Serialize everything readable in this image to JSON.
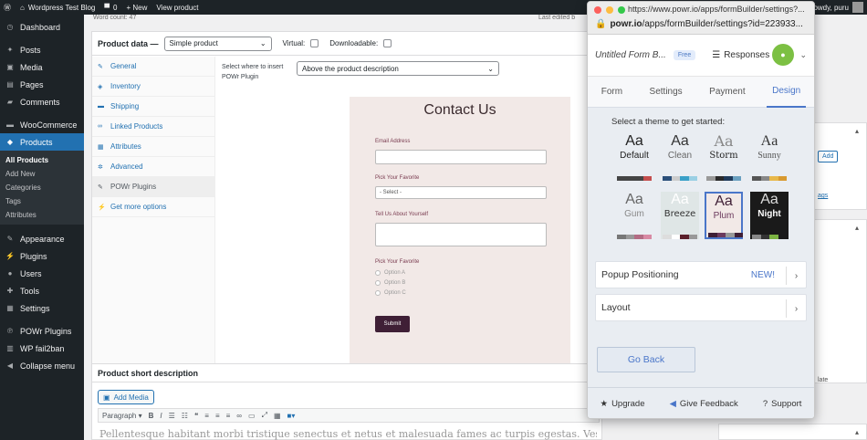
{
  "admin_bar": {
    "site_name": "Wordpress Test Blog",
    "comments_count": "0",
    "new_label": "+ New",
    "view_product": "View product",
    "howdy": "owdy, puru",
    "word_count": "Word count: 47",
    "last_edited": "Last edited b"
  },
  "sidebar": {
    "items": [
      {
        "label": "Dashboard",
        "icon": "gauge-icon"
      },
      {
        "label": "Posts",
        "icon": "pin-icon"
      },
      {
        "label": "Media",
        "icon": "media-icon"
      },
      {
        "label": "Pages",
        "icon": "pages-icon"
      },
      {
        "label": "Comments",
        "icon": "comments-icon"
      },
      {
        "label": "WooCommerce",
        "icon": "woo-icon"
      },
      {
        "label": "Products",
        "icon": "products-icon"
      }
    ],
    "submenu": [
      "All Products",
      "Add New",
      "Categories",
      "Tags",
      "Attributes"
    ],
    "items2": [
      {
        "label": "Appearance",
        "icon": "brush-icon"
      },
      {
        "label": "Plugins",
        "icon": "plugin-icon"
      },
      {
        "label": "Users",
        "icon": "users-icon"
      },
      {
        "label": "Tools",
        "icon": "tools-icon"
      },
      {
        "label": "Settings",
        "icon": "settings-icon"
      }
    ],
    "items3": [
      {
        "label": "POWr Plugins",
        "icon": "powr-icon"
      },
      {
        "label": "WP fail2ban",
        "icon": "shield-icon"
      },
      {
        "label": "Collapse menu",
        "icon": "collapse-icon"
      }
    ]
  },
  "product_data": {
    "title": "Product data —",
    "type": "Simple product",
    "virtual": "Virtual:",
    "downloadable": "Downloadable:",
    "tabs": [
      "General",
      "Inventory",
      "Shipping",
      "Linked Products",
      "Attributes",
      "Advanced",
      "POWr Plugins",
      "Get more options"
    ],
    "insert_label": "Select where to insert POWr Plugin",
    "insert_value": "Above the product description"
  },
  "form_preview": {
    "title": "Contact Us",
    "email_label": "Email Address",
    "pick_label": "Pick Your Favorite",
    "select_placeholder": "- Select -",
    "about_label": "Tell Us About Yourself",
    "pick_label_2": "Pick Your Favorite",
    "options": [
      "Option A",
      "Option B",
      "Option C"
    ],
    "submit": "Submit"
  },
  "short_desc": {
    "title": "Product short description",
    "add_media": "Add Media",
    "paragraph": "Paragraph",
    "body_text": "Pellentesque habitant morbi tristique senectus et netus et malesuada fames ac turpis egestas. Vestibulum tortor quam, feugiat vitae"
  },
  "right_col": {
    "add": "Add",
    "tags_link": "ags",
    "late": "late"
  },
  "popup": {
    "url": "https://www.powr.io/apps/formBuilder/settings?...",
    "path_domain": "powr.io",
    "path_rest": "/apps/formBuilder/settings?id=223933...",
    "form_title": "Untitled Form B...",
    "free_badge": "Free",
    "responses": "Responses",
    "tabs": [
      "Form",
      "Settings",
      "Payment",
      "Design"
    ],
    "active_tab": "Design",
    "theme_heading": "Select a theme to get started:",
    "themes": [
      {
        "name": "Default",
        "colors": [
          "#444444",
          "#444444",
          "#444444",
          "#c44e4e"
        ]
      },
      {
        "name": "Clean",
        "colors": [
          "#2b4f7a",
          "#cccccc",
          "#3aa0c8",
          "#9ad0e4"
        ]
      },
      {
        "name": "Storm",
        "colors": [
          "#999999",
          "#2a2a2a",
          "#1f3a5a",
          "#6aa0c0"
        ]
      },
      {
        "name": "Sunny",
        "colors": [
          "#555555",
          "#888888",
          "#e8b84a",
          "#d89a30"
        ]
      },
      {
        "name": "Gum",
        "colors": [
          "#777777",
          "#999999",
          "#b36c84",
          "#d88aa4"
        ]
      },
      {
        "name": "Breeze",
        "colors": [
          "#dddddd",
          "#ffffff",
          "#5a1f2a",
          "#999999"
        ]
      },
      {
        "name": "Plum",
        "colors": [
          "#3f1f36",
          "#6c3a5d",
          "#999999",
          "#3f1f36"
        ]
      },
      {
        "name": "Night",
        "colors": [
          "#888888",
          "#333333",
          "#7cb342",
          "#1a1a1a"
        ]
      }
    ],
    "popup_positioning": "Popup Positioning",
    "new_badge": "NEW!",
    "layout": "Layout",
    "go_back": "Go Back",
    "upgrade": "Upgrade",
    "give_feedback": "Give Feedback",
    "support": "Support",
    "accent": "#4a76c9",
    "avatar_color": "#7cc043"
  }
}
